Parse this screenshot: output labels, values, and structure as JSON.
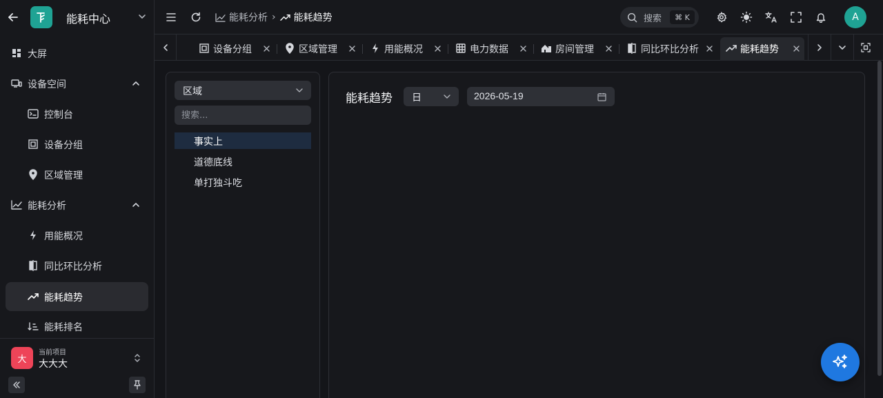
{
  "app": {
    "title": "能耗中心"
  },
  "sidebar": {
    "items": [
      {
        "label": "大屏",
        "icon": "dashboard-icon"
      },
      {
        "label": "设备空间",
        "icon": "device-space-icon"
      },
      {
        "label": "控制台",
        "icon": "console-icon"
      },
      {
        "label": "设备分组",
        "icon": "device-group-icon"
      },
      {
        "label": "区域管理",
        "icon": "location-pin-icon"
      },
      {
        "label": "能耗分析",
        "icon": "line-chart-icon"
      },
      {
        "label": "用能概况",
        "icon": "lightning-icon"
      },
      {
        "label": "同比环比分析",
        "icon": "compare-icon"
      },
      {
        "label": "能耗趋势",
        "icon": "trend-icon"
      },
      {
        "label": "能耗排名",
        "icon": "ranking-icon"
      }
    ],
    "project": {
      "avatar": "大",
      "caption": "当前项目",
      "name": "大大大"
    }
  },
  "header": {
    "breadcrumb": {
      "parent": "能耗分析",
      "separator": "›",
      "current": "能耗趋势"
    },
    "search": {
      "label": "搜索",
      "shortcut": "⌘ K"
    },
    "user_avatar": "A"
  },
  "tabs": [
    {
      "label": "设备分组",
      "icon": "device-group-icon"
    },
    {
      "label": "区域管理",
      "icon": "location-pin-icon"
    },
    {
      "label": "用能概况",
      "icon": "lightning-icon"
    },
    {
      "label": "电力数据",
      "icon": "table-icon"
    },
    {
      "label": "房间管理",
      "icon": "house-icon"
    },
    {
      "label": "同比环比分析",
      "icon": "compare-icon"
    },
    {
      "label": "能耗趋势",
      "icon": "trend-icon",
      "active": true
    }
  ],
  "tree": {
    "selector": "区域",
    "search_placeholder": "搜索...",
    "nodes": [
      "事实上",
      "道德底线",
      "单打独斗吃"
    ]
  },
  "main": {
    "title": "能耗趋势",
    "period": "日",
    "date": "2026-05-19"
  },
  "colors": {
    "brand": "#1fa394",
    "primary": "#1f78e0",
    "project_avatar": "#ee4458"
  }
}
